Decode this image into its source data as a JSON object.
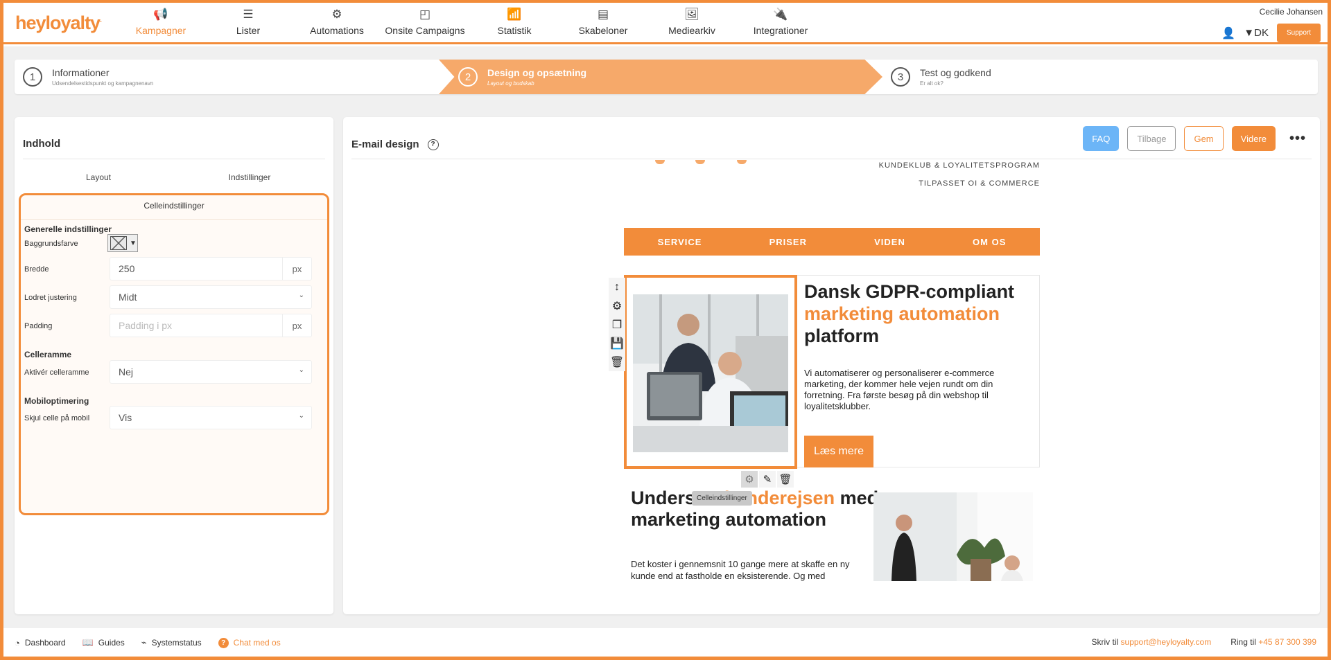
{
  "header": {
    "logo": "heyloyalty",
    "nav": [
      {
        "label": "Kampagner",
        "icon": "megaphone-icon",
        "active": true
      },
      {
        "label": "Lister",
        "icon": "list-icon"
      },
      {
        "label": "Automations",
        "icon": "gears-icon"
      },
      {
        "label": "Onsite Campaigns",
        "icon": "square-icon"
      },
      {
        "label": "Statistik",
        "icon": "chart-icon"
      },
      {
        "label": "Skabeloner",
        "icon": "template-icon"
      },
      {
        "label": "Mediearkiv",
        "icon": "image-icon"
      },
      {
        "label": "Integrationer",
        "icon": "plug-icon"
      }
    ],
    "user": "Cecilie Johansen",
    "lang": "▼DK",
    "support": "Support"
  },
  "stepper": {
    "steps": [
      {
        "num": "1",
        "title": "Informationer",
        "sub": "Udsendelsestidspunkt og kampagnenavn"
      },
      {
        "num": "2",
        "title": "Design og opsætning",
        "sub": "Layout og budskab"
      },
      {
        "num": "3",
        "title": "Test og godkend",
        "sub": "Er alt ok?"
      }
    ]
  },
  "left": {
    "title": "Indhold",
    "tabs": [
      "Layout",
      "Indstillinger"
    ],
    "cell": {
      "title": "Celleindstillinger",
      "general": "Generelle indstillinger",
      "bg_label": "Baggrundsfarve",
      "width_label": "Bredde",
      "width_value": "250",
      "unit": "px",
      "valign_label": "Lodret justering",
      "valign_value": "Midt",
      "padding_label": "Padding",
      "padding_placeholder": "Padding i px",
      "border_head": "Celleramme",
      "border_label": "Aktivér celleramme",
      "border_value": "Nej",
      "mobile_head": "Mobiloptimering",
      "mobile_label": "Skjul celle på mobil",
      "mobile_value": "Vis"
    }
  },
  "right": {
    "title": "E-mail design",
    "buttons": {
      "faq": "FAQ",
      "back": "Tilbage",
      "save": "Gem",
      "next": "Videre"
    },
    "email": {
      "tag1": "KUNDEKLUB & LOYALITETSPROGRAM",
      "tag2": "TILPASSET OI & COMMERCE",
      "nav": [
        "SERVICE",
        "PRISER",
        "VIDEN",
        "OM OS"
      ],
      "h1a": "Dansk GDPR-compliant ",
      "h1b": "marketing automation",
      "h1c": " platform",
      "p1": "Vi automatiserer og personaliserer e-commerce marketing, der kommer hele vejen rundt om din forretning. Fra første besøg på din webshop til loyalitetsklubber.",
      "cta": "Læs mere",
      "tooltip": "Celleindstillinger",
      "h2a": "Understøt ",
      "h2b": "kunderejsen",
      "h2c": " med marketing automation",
      "p2": "Det koster i gennemsnit 10 gange mere at skaffe en ny kunde end at fastholde en eksisterende. Og med"
    }
  },
  "footer": {
    "items": [
      "Dashboard",
      "Guides",
      "Systemstatus",
      "Chat med os"
    ],
    "write": "Skriv til",
    "email": "support@heyloyalty.com",
    "call": "Ring til",
    "phone": "+45 87 300 399"
  },
  "colors": {
    "accent": "#f28c3a",
    "faq": "#6cb5f7"
  }
}
